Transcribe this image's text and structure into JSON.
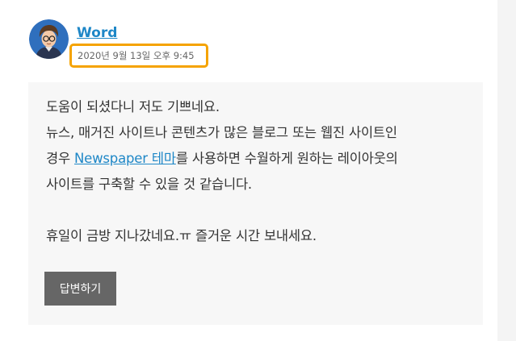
{
  "comment": {
    "author": "Word",
    "timestamp": "2020년 9월 13일 오후 9:45",
    "lines": {
      "l1": "도움이 되셨다니 저도 기쁘네요.",
      "l2": "뉴스, 매거진 사이트나 콘텐츠가 많은 블로그 또는 웹진 사이트인",
      "l3_before": "경우 ",
      "l3_link": "Newspaper 테마",
      "l3_after": "를 사용하면 수월하게 원하는 레이아웃의",
      "l4": "사이트를 구축할 수 있을 것 같습니다.",
      "l5": "휴일이 금방 지나갔네요.ㅠ 즐거운 시간 보내세요."
    },
    "reply_label": "답변하기"
  },
  "colors": {
    "link": "#1e87c7",
    "highlight_border": "#f5a300",
    "button_bg": "#666666",
    "body_bg": "#f7f7f7"
  }
}
